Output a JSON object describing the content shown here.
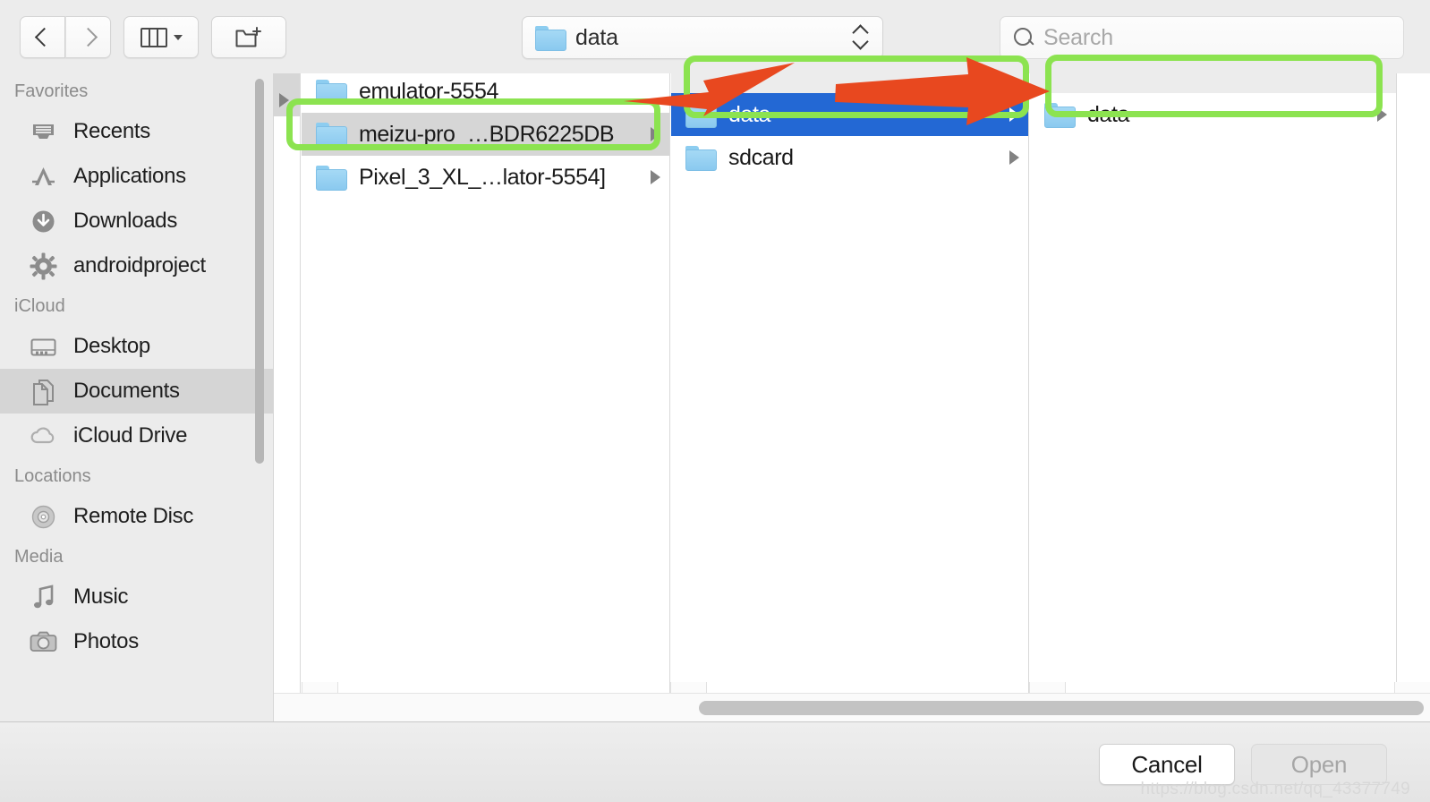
{
  "toolbar": {
    "back_icon": "chevron-left-icon",
    "forward_icon": "chevron-right-icon",
    "view_mode_icon": "columns-view-icon",
    "view_mode_caret": "chevron-down-icon",
    "new_folder_icon": "new-folder-icon",
    "path_popup": {
      "icon": "folder-icon",
      "value": "data",
      "stepper_icon": "up-down-stepper-icon"
    },
    "search": {
      "icon": "search-icon",
      "placeholder": "Search",
      "value": ""
    }
  },
  "sidebar": {
    "groups": [
      {
        "title": "Favorites",
        "items": [
          {
            "label": "Recents",
            "icon": "recents-icon",
            "selected": false
          },
          {
            "label": "Applications",
            "icon": "applications-icon",
            "selected": false
          },
          {
            "label": "Downloads",
            "icon": "downloads-icon",
            "selected": false
          },
          {
            "label": "androidproject",
            "icon": "gear-icon",
            "selected": false
          }
        ]
      },
      {
        "title": "iCloud",
        "items": [
          {
            "label": "Desktop",
            "icon": "desktop-icon",
            "selected": false
          },
          {
            "label": "Documents",
            "icon": "documents-icon",
            "selected": true
          },
          {
            "label": "iCloud Drive",
            "icon": "icloud-drive-icon",
            "selected": false
          }
        ]
      },
      {
        "title": "Locations",
        "items": [
          {
            "label": "Remote Disc",
            "icon": "disc-icon",
            "selected": false
          }
        ]
      },
      {
        "title": "Media",
        "items": [
          {
            "label": "Music",
            "icon": "music-note-icon",
            "selected": false
          },
          {
            "label": "Photos",
            "icon": "camera-icon",
            "selected": false
          }
        ]
      }
    ]
  },
  "browser": {
    "columns": [
      {
        "name": "column-scrolled-partial",
        "rows": [
          {
            "label": "",
            "icon": "",
            "has_disclosure": true,
            "selection": "none"
          }
        ]
      },
      {
        "name": "column-devices",
        "rows": [
          {
            "label": "emulator-5554",
            "icon": "folder-icon",
            "has_disclosure": false,
            "selection": "none"
          },
          {
            "label": "meizu-pro_…BDR6225DB",
            "icon": "folder-icon",
            "has_disclosure": true,
            "selection": "gray"
          },
          {
            "label": "Pixel_3_XL_…lator-5554]",
            "icon": "folder-icon",
            "has_disclosure": true,
            "selection": "none"
          }
        ]
      },
      {
        "name": "column-device-root",
        "rows": [
          {
            "label": "data",
            "icon": "folder-icon",
            "has_disclosure": true,
            "selection": "blue"
          },
          {
            "label": "sdcard",
            "icon": "folder-icon",
            "has_disclosure": true,
            "selection": "none"
          }
        ]
      },
      {
        "name": "column-data-children",
        "rows": [
          {
            "label": "data",
            "icon": "folder-icon",
            "has_disclosure": true,
            "selection": "none"
          }
        ]
      },
      {
        "name": "column-empty",
        "rows": []
      }
    ],
    "horizontal_scrollbar": "h-scrollbar"
  },
  "footer": {
    "cancel_label": "Cancel",
    "open_label": "Open",
    "open_disabled": true,
    "watermark": "https://blog.csdn.net/qq_43377749"
  },
  "annotations": {
    "highlight_color": "#8ce350",
    "arrow_color": "#e8481f",
    "rects": [
      {
        "name": "highlight-device-row"
      },
      {
        "name": "highlight-data-row"
      },
      {
        "name": "highlight-data-child-row"
      }
    ],
    "arrows": [
      {
        "name": "arrow-device-to-data"
      },
      {
        "name": "arrow-data-to-child"
      }
    ]
  },
  "colors": {
    "selection_blue": "#2368d4",
    "selection_gray": "#d6d6d6",
    "folder_blue": "#8ac9ef",
    "chrome_gray": "#ececec"
  }
}
